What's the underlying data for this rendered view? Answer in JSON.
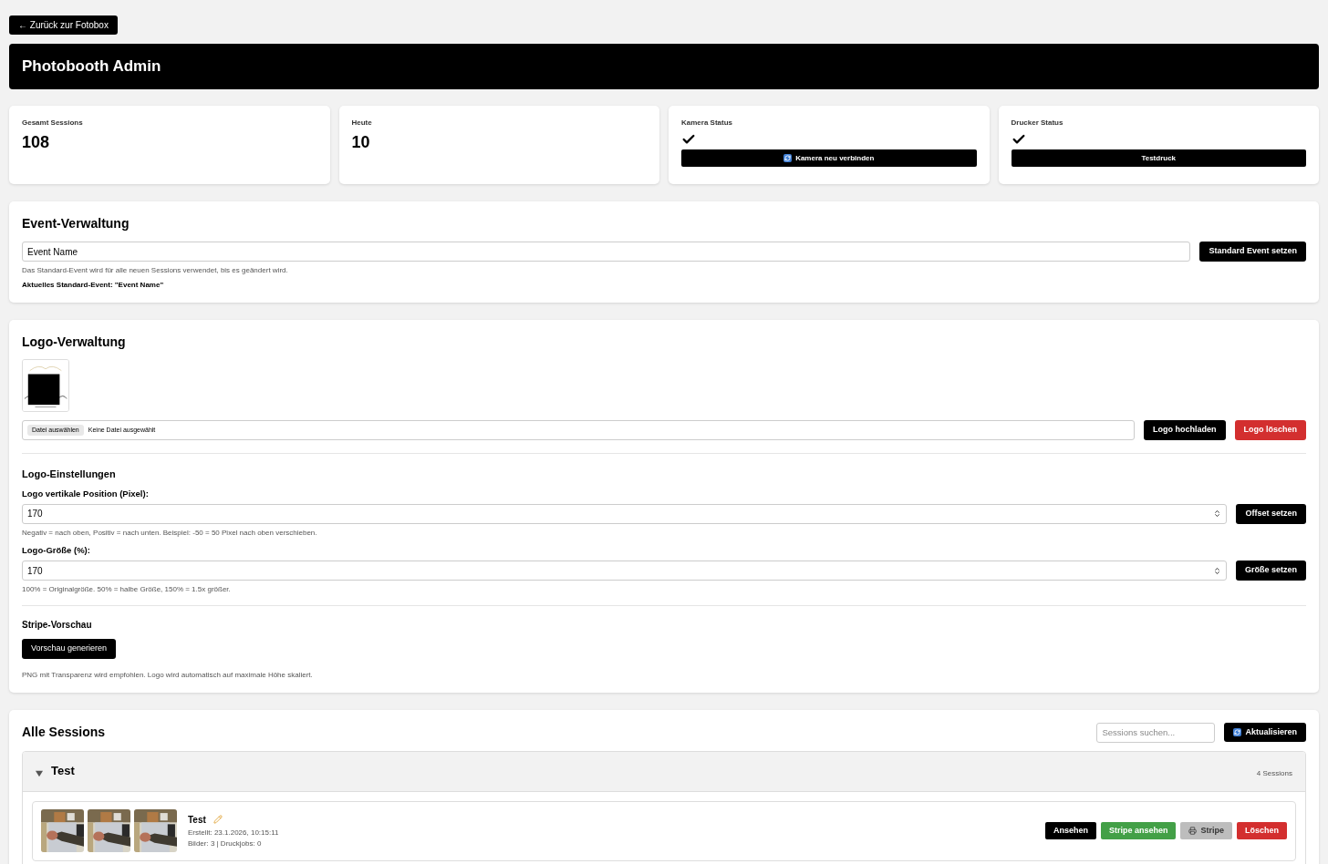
{
  "back_button": "← Zurück zur Fotobox",
  "header": {
    "title": "Photobooth Admin"
  },
  "stats": [
    {
      "kind": "count",
      "label": "Gesamt Sessions",
      "value": "108"
    },
    {
      "kind": "count",
      "label": "Heute",
      "value": "10"
    },
    {
      "kind": "status",
      "label": "Kamera Status",
      "ok": true,
      "button": {
        "kind": "refresh",
        "label": "Kamera neu verbinden"
      }
    },
    {
      "kind": "status",
      "label": "Drucker Status",
      "ok": true,
      "button": {
        "kind": "plain",
        "label": "Testdruck"
      }
    }
  ],
  "event": {
    "title": "Event-Verwaltung",
    "value": "Event Name",
    "button": "Standard Event setzen",
    "hint": "Das Standard-Event wird für alle neuen Sessions verwendet, bis es geändert wird.",
    "current": "Aktuelles Standard-Event: \"Event Name\""
  },
  "logo": {
    "title": "Logo-Verwaltung",
    "file_button": "Datei auswählen",
    "file_status": "Keine Datei ausgewählt",
    "upload_button": "Logo hochladen",
    "delete_button": "Logo löschen",
    "settings_title": "Logo-Einstellungen",
    "settings": [
      {
        "label": "Logo vertikale Position (Pixel):",
        "value": "170",
        "button": "Offset setzen",
        "hint": "Negativ = nach oben, Positiv = nach unten. Beispiel: -50 = 50 Pixel nach oben verschieben."
      },
      {
        "label": "Logo-Größe (%):",
        "value": "170",
        "button": "Größe setzen",
        "hint": "100% = Originalgröße. 50% = halbe Größe, 150% = 1.5x größer."
      }
    ],
    "preview_title": "Stripe-Vorschau",
    "preview_button": "Vorschau generieren",
    "note": "PNG mit Transparenz wird empfohlen. Logo wird automatisch auf maximale Höhe skaliert."
  },
  "sessions": {
    "title": "Alle Sessions",
    "search_placeholder": "Sessions suchen...",
    "refresh_button": "Aktualisieren",
    "groups": [
      {
        "name": "Test",
        "count": "4 Sessions",
        "expanded": true,
        "items": [
          {
            "title": "Test",
            "created": "Erstellt: 23.1.2026, 10:15:11",
            "info": "Bilder: 3 | Druckjobs: 0",
            "actions": [
              {
                "kind": "view",
                "label": "Ansehen"
              },
              {
                "kind": "stripe_view",
                "label": "Stripe ansehen"
              },
              {
                "kind": "stripe_print",
                "label": "Stripe"
              },
              {
                "kind": "delete",
                "label": "Löschen"
              }
            ]
          }
        ]
      }
    ]
  }
}
